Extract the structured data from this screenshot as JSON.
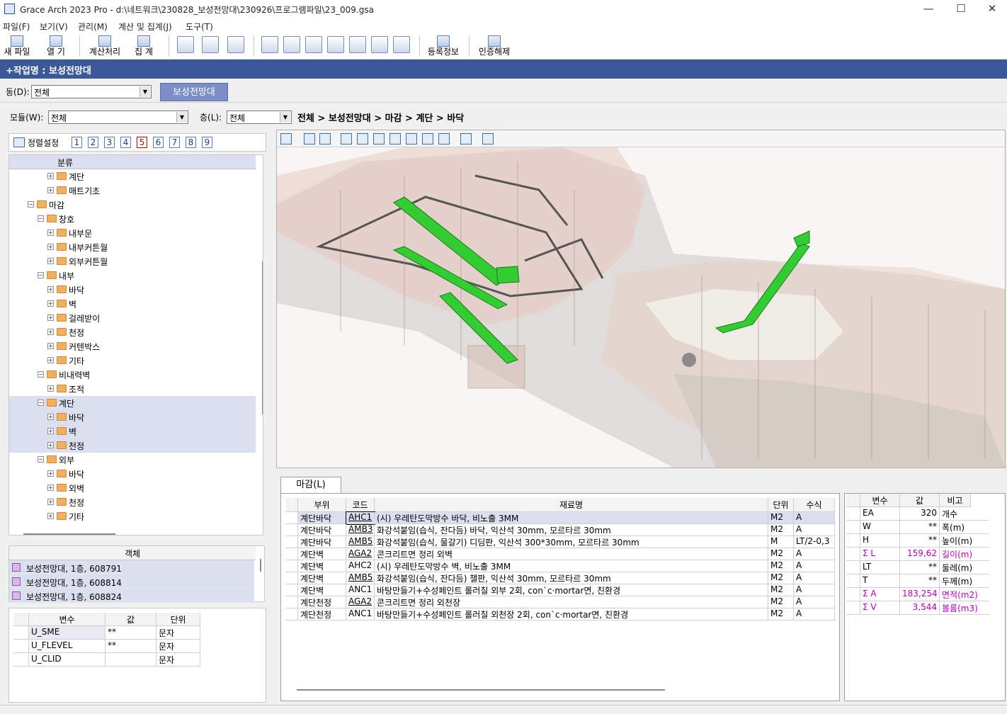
{
  "window": {
    "title": "Grace Arch 2023 Pro - d:\\네트워크\\230828_보성전망대\\230926\\프로그램파일\\23_009.gsa",
    "minimize": "—",
    "maximize": "☐",
    "close": "✕"
  },
  "menu": [
    "파일(F)",
    "보기(V)",
    "관리(M)",
    "계산 및 집계(J)",
    "도구(T)"
  ],
  "toolbar": {
    "new": "새 파일",
    "open": "열  기",
    "calc": "계산처리",
    "sum": "집  계",
    "register": "등록정보",
    "unauth": "인증해제"
  },
  "job": {
    "label": "+작업명 : 보성전망대"
  },
  "dong": {
    "label": "동(D):",
    "value": "전체",
    "tab": "보성전망대"
  },
  "module": {
    "label": "모듈(W):",
    "value": "전체"
  },
  "floor": {
    "label": "층(L):",
    "value": "전체"
  },
  "breadcrumb": "전체 > 보성전망대 > 마감 > 계단 > 바닥",
  "sortbar": {
    "label": "정렬설정",
    "tabs": [
      "1",
      "2",
      "3",
      "4",
      "5",
      "6",
      "7",
      "8",
      "9"
    ],
    "active": "5"
  },
  "tree": {
    "header": "분류",
    "nodes": [
      {
        "label": "계단",
        "lvl": 3,
        "exp": "+"
      },
      {
        "label": "매트기초",
        "lvl": 3,
        "exp": "+"
      },
      {
        "label": "마감",
        "lvl": 1,
        "exp": "-"
      },
      {
        "label": "창호",
        "lvl": 2,
        "exp": "-"
      },
      {
        "label": "내부문",
        "lvl": 3,
        "exp": "+"
      },
      {
        "label": "내부커튼월",
        "lvl": 3,
        "exp": "+"
      },
      {
        "label": "외부커튼월",
        "lvl": 3,
        "exp": "+"
      },
      {
        "label": "내부",
        "lvl": 2,
        "exp": "-"
      },
      {
        "label": "바닥",
        "lvl": 3,
        "exp": "+"
      },
      {
        "label": "벽",
        "lvl": 3,
        "exp": "+"
      },
      {
        "label": "걸레받이",
        "lvl": 3,
        "exp": "+"
      },
      {
        "label": "천정",
        "lvl": 3,
        "exp": "+"
      },
      {
        "label": "커텐박스",
        "lvl": 3,
        "exp": "+"
      },
      {
        "label": "기타",
        "lvl": 3,
        "exp": "+"
      },
      {
        "label": "비내력벽",
        "lvl": 2,
        "exp": "-"
      },
      {
        "label": "조적",
        "lvl": 3,
        "exp": "+"
      },
      {
        "label": "계단",
        "lvl": 2,
        "exp": "-",
        "sel": true
      },
      {
        "label": "바닥",
        "lvl": 3,
        "exp": "+",
        "sel": true
      },
      {
        "label": "벽",
        "lvl": 3,
        "exp": "+",
        "sel": true
      },
      {
        "label": "천정",
        "lvl": 3,
        "exp": "+",
        "sel": true
      },
      {
        "label": "외부",
        "lvl": 2,
        "exp": "-"
      },
      {
        "label": "바닥",
        "lvl": 3,
        "exp": "+"
      },
      {
        "label": "외벽",
        "lvl": 3,
        "exp": "+"
      },
      {
        "label": "천정",
        "lvl": 3,
        "exp": "+"
      },
      {
        "label": "기타",
        "lvl": 3,
        "exp": "+"
      }
    ]
  },
  "objects": {
    "header": "객체",
    "rows": [
      "보성전망대, 1층, 608791",
      "보성전망대, 1층, 608814",
      "보성전망대, 1층, 608824"
    ]
  },
  "vars": {
    "headers": [
      "변수",
      "값",
      "단위"
    ],
    "rows": [
      [
        "U_SME",
        "**",
        "문자"
      ],
      [
        "U_FLEVEL",
        "**",
        "문자"
      ],
      [
        "U_CLID",
        "",
        "문자"
      ]
    ]
  },
  "materials": {
    "tab": "마감(L)",
    "headers": [
      "부위",
      "코드",
      "재료명",
      "단위",
      "수식"
    ],
    "rows": [
      [
        "계단바닥",
        "AHC1",
        "(시) 우레탄도막방수  바닥, 비노출 3MM",
        "M2",
        "A"
      ],
      [
        "계단바닥",
        "AMB3",
        "화강석붙임(습식, 잔다듬)  바닥, 익산석 30mm, 모르타르 30mm",
        "M2",
        "A"
      ],
      [
        "계단바닥",
        "AMB5",
        "화강석붙임(습식, 물갈기)  디딤판, 익산석 300*30mm, 모르타르 30mm",
        "M",
        "LT/2-0,3"
      ],
      [
        "계단벽",
        "AGA2",
        "콘크리트면 정리  외벽",
        "M2",
        "A"
      ],
      [
        "계단벽",
        "AHC2",
        "(시) 우레탄도막방수  벽, 비노출 3MM",
        "M2",
        "A"
      ],
      [
        "계단벽",
        "AMB5",
        "화강석붙임(습식, 잔다듬)  챌판, 익산석 30mm, 모르타르 30mm",
        "M2",
        "A"
      ],
      [
        "계단벽",
        "ANC1",
        "바탕만들기+수성페인트 롤러칠  외부 2회, con`c·mortar면, 친환경",
        "M2",
        "A"
      ],
      [
        "계단천정",
        "AGA2",
        "콘크리트면 정리  외천장",
        "M2",
        "A"
      ],
      [
        "계단천정",
        "ANC1",
        "바탕만들기+수성페인트 롤러칠  외천장 2회, con`c·mortar면, 친환경",
        "M2",
        "A"
      ]
    ]
  },
  "eval": {
    "headers": [
      "변수",
      "값",
      "비고"
    ],
    "rows": [
      [
        "EA",
        "320",
        "개수",
        false
      ],
      [
        "W",
        "**",
        "폭(m)",
        false
      ],
      [
        "H",
        "**",
        "높이(m)",
        false
      ],
      [
        "Σ L",
        "159,62",
        "길이(m)",
        true
      ],
      [
        "LT",
        "**",
        "둘레(m)",
        false
      ],
      [
        "T",
        "**",
        "두께(m)",
        false
      ],
      [
        "Σ A",
        "183,254",
        "면적(m2)",
        true
      ],
      [
        "Σ V",
        "3,544",
        "볼륨(m3)",
        true
      ]
    ]
  }
}
